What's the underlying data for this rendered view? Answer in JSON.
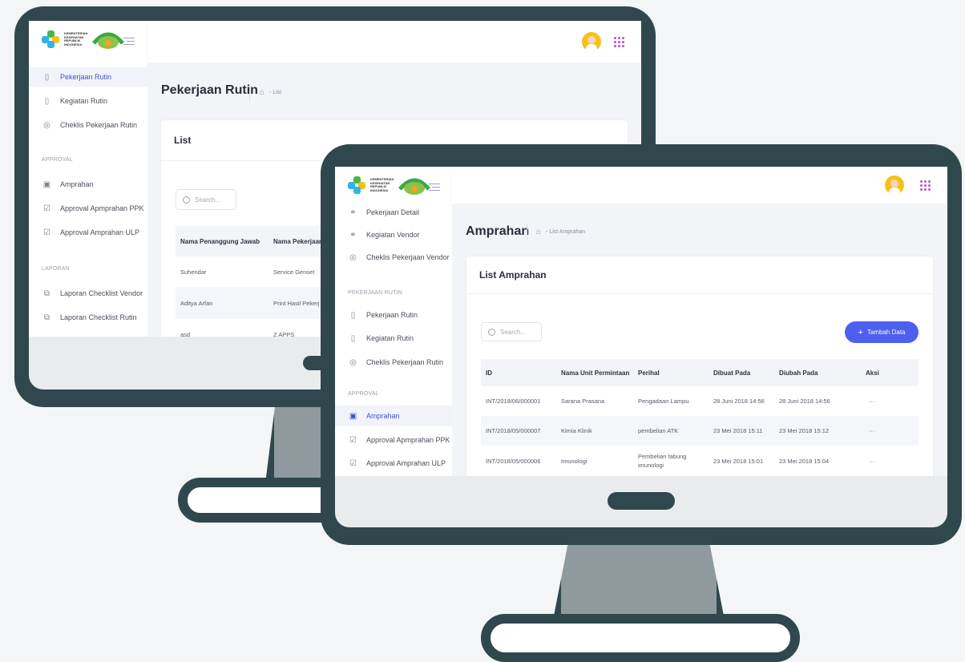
{
  "colors": {
    "bezel": "#30474e",
    "accent": "#4e5ff0",
    "active_text": "#3f51d8",
    "page_bg": "#f4f5f6"
  },
  "back": {
    "sidebar": {
      "items": [
        {
          "label": "Pekerjaan Rutin",
          "icon": "building-icon",
          "active": true
        },
        {
          "label": "Kegiatan Rutin",
          "icon": "building-icon"
        },
        {
          "label": "Cheklis Pekerjaan Rutin",
          "icon": "check-circle-icon"
        }
      ],
      "section_approval": "APPROVAL",
      "approval_items": [
        {
          "label": "Amprahan",
          "icon": "box-icon"
        },
        {
          "label": "Approval Apmprahan PPK",
          "icon": "checkbox-icon"
        },
        {
          "label": "Approval Amprahan ULP",
          "icon": "checkbox-icon"
        }
      ],
      "section_laporan": "LAPORAN",
      "laporan_items": [
        {
          "label": "Laporan Checklist Vendor",
          "icon": "copy-icon"
        },
        {
          "label": "Laporan Checklist Rutin",
          "icon": "copy-icon"
        }
      ]
    },
    "page_title": "Pekerjaan Rutin",
    "breadcrumb": "- List",
    "card_title": "List",
    "search_placeholder": "Search...",
    "columns": [
      "Nama Penanggung Jawab",
      "Nama Pekerjaan"
    ],
    "rows": [
      [
        "Suhendar",
        "Service Genset"
      ],
      [
        "Aditya Arfan",
        "Print Hasil Pekerj"
      ],
      [
        "asd",
        "Z APPS"
      ]
    ]
  },
  "front": {
    "sidebar": {
      "top_items": [
        {
          "label": "Pekerjaan Detail",
          "icon": "handshake-icon"
        },
        {
          "label": "Kegiatan Vendor",
          "icon": "handshake-icon"
        },
        {
          "label": "Cheklis Pekerjaan Vendor",
          "icon": "check-circle-icon"
        }
      ],
      "section_rutin": "PEKERJAAN RUTIN",
      "rutin_items": [
        {
          "label": "Pekerjaan Rutin",
          "icon": "building-icon"
        },
        {
          "label": "Kegiatan Rutin",
          "icon": "building-icon"
        },
        {
          "label": "Cheklis Pekerjaan Rutin",
          "icon": "check-circle-icon"
        }
      ],
      "section_approval": "APPROVAL",
      "approval_items": [
        {
          "label": "Amprahan",
          "icon": "box-icon",
          "active": true
        },
        {
          "label": "Approval Apmprahan PPK",
          "icon": "checkbox-icon"
        },
        {
          "label": "Approval Amprahan ULP",
          "icon": "checkbox-icon"
        }
      ]
    },
    "page_title": "Amprahan",
    "breadcrumb": "- List Amprahan",
    "card_title": "List Amprahan",
    "search_placeholder": "Search...",
    "add_button": "Tambah Data",
    "columns": [
      "ID",
      "Nama Unit Permintaan",
      "Perihal",
      "Dibuat Pada",
      "Diubah Pada",
      "Aksi"
    ],
    "rows": [
      [
        "INT/2018/06/000001",
        "Sarana Prasana",
        "Pengadaan Lampu",
        "28 Juni 2018 14:56",
        "28 Juni 2018 14:56",
        "···"
      ],
      [
        "INT/2018/05/000007",
        "Kimia Klinik",
        "pembelian ATK",
        "23 Mei 2018 15:11",
        "23 Mei 2018 15:12",
        "···"
      ],
      [
        "INT/2018/05/000006",
        "Imunologi",
        "Pembelian tabung imunologi",
        "23 Mei 2018 15:01",
        "23 Mei 2018 15:04",
        "···"
      ]
    ]
  }
}
